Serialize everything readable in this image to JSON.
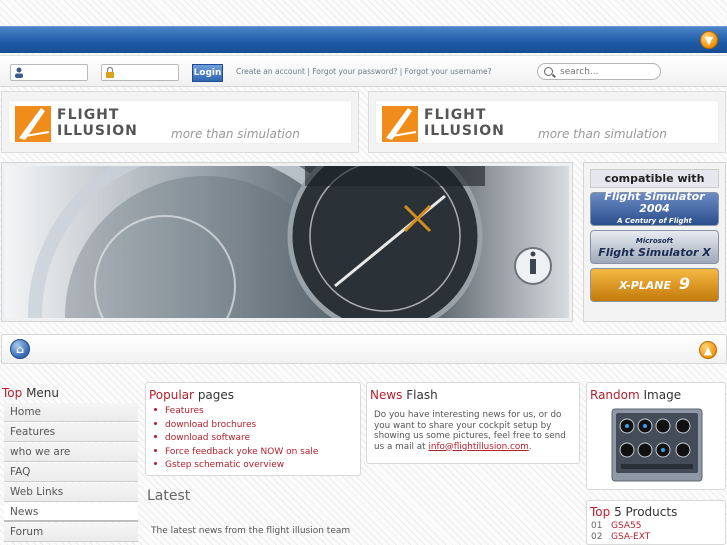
{
  "header": {
    "download_icon": "orange-arrow-down-icon"
  },
  "login": {
    "username_icon": "user-icon",
    "password_icon": "lock-icon",
    "login_label": "Login",
    "links": [
      "Create an account",
      "Forgot your password?",
      "Forgot your username?"
    ],
    "separator": "|"
  },
  "search": {
    "placeholder": "search..."
  },
  "logos": [
    {
      "name_line1": "FLIGHT",
      "name_line2": "ILLUSION",
      "tagline": "more than simulation"
    },
    {
      "name_line1": "FLIGHT",
      "name_line2": "ILLUSION",
      "tagline": "more than simulation"
    }
  ],
  "compat": {
    "title": "compatible with",
    "badges": [
      {
        "line1": "Flight Simulator 2004",
        "line2": "A Century of Flight"
      },
      {
        "line1": "Microsoft",
        "line2": "Flight Simulator X"
      },
      {
        "line1": "X-PLANE",
        "line2": "9"
      }
    ]
  },
  "nav": {
    "home_icon": "home-icon",
    "up_icon": "arrow-up-icon"
  },
  "top_menu": {
    "title_hl": "Top",
    "title_rest": " Menu",
    "items": [
      "Home",
      "Features",
      "who we are",
      "FAQ",
      "Web Links",
      "News",
      "Forum"
    ],
    "active_index": 5
  },
  "popular": {
    "title_hl": "Popular",
    "title_rest": " pages",
    "items": [
      "Features",
      "download brochures",
      "download software",
      "Force feedback yoke NOW on sale",
      "Gstep schematic overview"
    ]
  },
  "latest": {
    "title": "Latest",
    "text": "The latest news from the flight illusion team"
  },
  "news_flash": {
    "title_hl": "News",
    "title_rest": " Flash",
    "body": "Do you have interesting news for us, or do you want to share your cockpit setup by showing us some pictures, feel free to send us a mail at ",
    "email": "info@flightillusion.com",
    "tail": "."
  },
  "random_image": {
    "title_hl": "Random",
    "title_rest": " Image"
  },
  "top_products": {
    "title_hl": "Top",
    "title_rest": " 5 Products",
    "items": [
      {
        "num": "01",
        "name": "GSA55"
      },
      {
        "num": "02",
        "name": "GSA-EXT"
      }
    ]
  }
}
